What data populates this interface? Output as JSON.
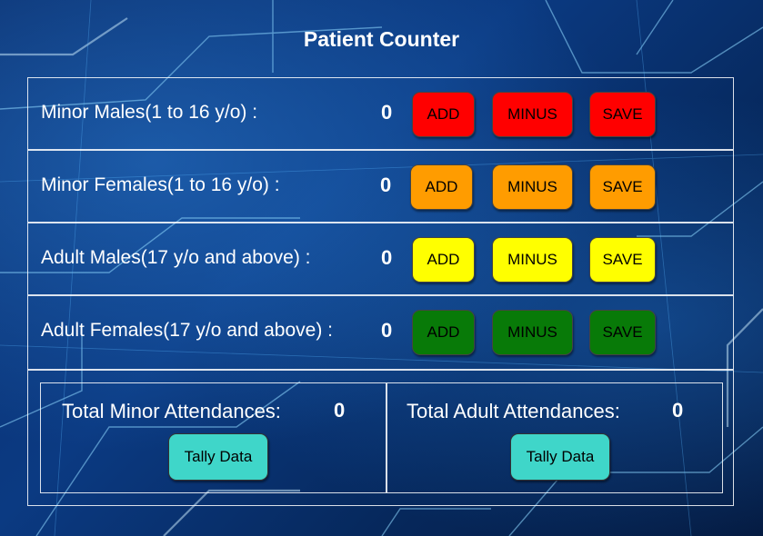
{
  "title": "Patient Counter",
  "rows": [
    {
      "label": "Minor Males(1 to 16 y/o) :",
      "count": "0",
      "color": "#ff0000",
      "add_label": "ADD",
      "minus_label": "MINUS",
      "save_label": "SAVE"
    },
    {
      "label": "Minor Females(1 to 16 y/o) :",
      "count": "0",
      "color": "#ff9c00",
      "add_label": "ADD",
      "minus_label": "MINUS",
      "save_label": "SAVE"
    },
    {
      "label": "Adult Males(17 y/o and above) :",
      "count": "0",
      "color": "#ffff00",
      "add_label": "ADD",
      "minus_label": "MINUS",
      "save_label": "SAVE"
    },
    {
      "label": "Adult Females(17 y/o and above) :",
      "count": "0",
      "color": "#087a08",
      "add_label": "ADD",
      "minus_label": "MINUS",
      "save_label": "SAVE"
    }
  ],
  "totals": {
    "minor_label": "Total Minor Attendances:",
    "minor_count": "0",
    "adult_label": "Total Adult Attendances:",
    "adult_count": "0",
    "tally_label": "Tally Data",
    "tally_color": "#3fd6c9"
  }
}
